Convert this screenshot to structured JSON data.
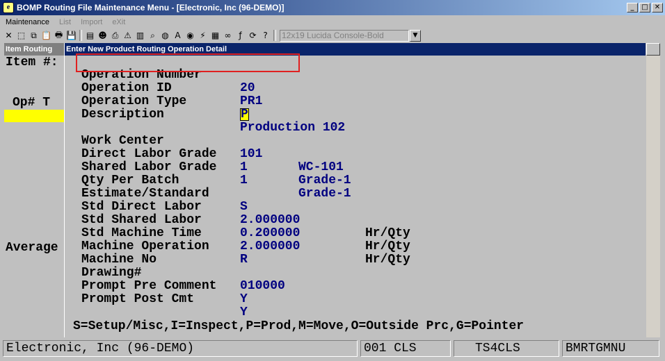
{
  "window": {
    "title": "BOMP Routing File Maintenance Menu - [Electronic, Inc (96-DEMO)]",
    "app_icon": "blue-e-logo-icon",
    "buttons": [
      "_",
      "□",
      "✕"
    ]
  },
  "menu": {
    "items": [
      "Maintenance",
      "List",
      "Import",
      "eXit"
    ]
  },
  "toolbar": {
    "font_select": "12x19 Lucida Console-Bold"
  },
  "background": {
    "tab_label": "Item Routing",
    "item_label": "Item #:",
    "op_header": "Op# T",
    "average_label": "Average"
  },
  "dialog": {
    "title": "Enter New Product Routing Operation Detail",
    "fields": {
      "operation_number": {
        "label": "Operation Number",
        "value": "20"
      },
      "operation_id": {
        "label": "Operation ID",
        "value": "PR1"
      },
      "operation_type": {
        "label": "Operation Type",
        "value": "P"
      },
      "description": {
        "label": "Description",
        "value": "Production 102"
      },
      "work_center": {
        "label": "Work Center",
        "value": "101",
        "desc": "WC-101"
      },
      "direct_labor_grade": {
        "label": "Direct Labor Grade",
        "value": "1",
        "desc": "Grade-1"
      },
      "shared_labor_grade": {
        "label": "Shared Labor Grade",
        "value": "1",
        "desc": "Grade-1"
      },
      "qty_per_batch": {
        "label": "Qty Per Batch",
        "value": ""
      },
      "estimate_standard": {
        "label": "Estimate/Standard",
        "value": "S"
      },
      "std_direct_labor": {
        "label": "Std Direct Labor",
        "value": "2.000000",
        "unit": "Hr/Qty"
      },
      "std_shared_labor": {
        "label": "Std Shared Labor",
        "value": "0.200000",
        "unit": "Hr/Qty"
      },
      "std_machine_time": {
        "label": "Std Machine Time",
        "value": "2.000000",
        "unit": "Hr/Qty"
      },
      "machine_operation": {
        "label": "Machine Operation",
        "value": "R"
      },
      "machine_no": {
        "label": "Machine No",
        "value": ""
      },
      "drawing": {
        "label": "Drawing#",
        "value": "010000"
      },
      "prompt_pre_comment": {
        "label": "Prompt Pre Comment",
        "value": "Y"
      },
      "prompt_post_cmt": {
        "label": "Prompt Post Cmt",
        "value": "Y"
      }
    },
    "legend": "S=Setup/Misc,I=Inspect,P=Prod,M=Move,O=Outside Prc,G=Pointer"
  },
  "status": {
    "company": "Electronic, Inc (96-DEMO)",
    "code": "001 CLS",
    "terminal": "TS4CLS",
    "program": "BMRTGMNU"
  },
  "colors": {
    "value_text": "#000080",
    "highlight_box": "#e02020",
    "dialog_title_bg": "#0a246a",
    "cursor_bg": "#ffff00"
  }
}
